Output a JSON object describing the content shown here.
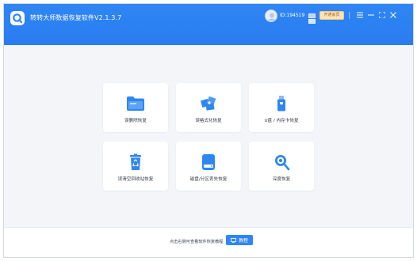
{
  "app": {
    "title": "转转大师数据恢复软件V2.1.3.7",
    "user_id": "ID:194519",
    "vip_button": "开通会员",
    "accent_color": "#2f86f3",
    "window_controls": [
      "monitor-icon",
      "menu-icon",
      "minimize-icon",
      "maximize-icon",
      "close-icon"
    ]
  },
  "options": [
    {
      "label": "误删除恢复",
      "icon": "folder-icon"
    },
    {
      "label": "误格式化恢复",
      "icon": "broken-puzzle-icon"
    },
    {
      "label": "U盘 / 内存卡恢复",
      "icon": "usb-drive-icon"
    },
    {
      "label": "误清空回收站恢复",
      "icon": "recycle-bin-icon"
    },
    {
      "label": "磁盘/分区丢失恢复",
      "icon": "hard-disk-icon"
    },
    {
      "label": "深度恢复",
      "icon": "deep-scan-icon"
    }
  ],
  "footer": {
    "hint": "点击右侧可查看软件恢复教程",
    "tutorial_button": "教程"
  }
}
